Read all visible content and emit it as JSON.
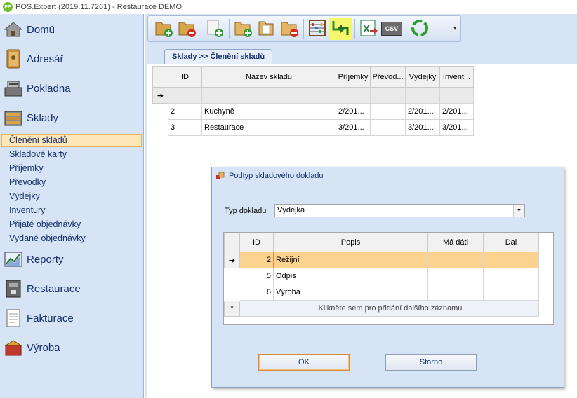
{
  "app": {
    "title": "POS.Expert (2019.11.7261) - Restaurace DEMO",
    "icon_text": "PE"
  },
  "sidebar": {
    "groups": [
      {
        "label": "Domů",
        "icon": "home-icon"
      },
      {
        "label": "Adresář",
        "icon": "address-book-icon"
      },
      {
        "label": "Pokladna",
        "icon": "cash-register-icon"
      },
      {
        "label": "Sklady",
        "icon": "warehouse-icon"
      },
      {
        "label": "Reporty",
        "icon": "chart-icon"
      },
      {
        "label": "Restaurace",
        "icon": "coffee-machine-icon"
      },
      {
        "label": "Fakturace",
        "icon": "invoice-icon"
      },
      {
        "label": "Výroba",
        "icon": "production-icon"
      }
    ],
    "sklady_items": [
      "Členění skladů",
      "Skladové karty",
      "Příjemky",
      "Převodky",
      "Výdejky",
      "Inventury",
      "Přijaté objednávky",
      "Vydané objednávky"
    ],
    "active_item": "Členění skladů"
  },
  "toolbar": {
    "buttons": [
      "add-folder-icon",
      "remove-folder-icon",
      "add-document-icon",
      "add-folder-alt-icon",
      "folder-icon",
      "remove-folder-alt-icon",
      "abacus-icon",
      "transfer-icon",
      "excel-export-icon",
      "csv-export-icon",
      "recycle-icon"
    ],
    "csv_label": "CSV",
    "overflow": "▾"
  },
  "tab": {
    "label": "Sklady >> Členění skladů"
  },
  "warehouse_grid": {
    "columns": [
      "ID",
      "Název skladu",
      "Příjemky",
      "Převod...",
      "Výdejky",
      "Invent..."
    ],
    "rows": [
      [
        "2",
        "Kuchyně",
        "2/201...",
        "",
        "2/201...",
        "2/201..."
      ],
      [
        "3",
        "Restaurace",
        "3/201...",
        "",
        "3/201...",
        "3/201..."
      ]
    ]
  },
  "dialog": {
    "title": "Podtyp skladového dokladu",
    "doctype_label": "Typ dokladu",
    "doctype_value": "Výdejka",
    "grid": {
      "columns": [
        "ID",
        "Popis",
        "Má dáti",
        "Dal"
      ],
      "rows": [
        [
          "2",
          "Režijní",
          "",
          ""
        ],
        [
          "5",
          "Odpis",
          "",
          ""
        ],
        [
          "6",
          "Výroba",
          "",
          ""
        ]
      ],
      "new_row_hint": "Klikněte sem pro přidání dalšího záznamu"
    },
    "ok_label": "OK",
    "cancel_label": "Storno"
  },
  "colors": {
    "sidebar_bg": "#d6e4f5",
    "accent_text": "#15306a",
    "selected_row": "#fcd28f",
    "active_nav": "#fde7b9",
    "highlight_button": "#f4f76b"
  }
}
